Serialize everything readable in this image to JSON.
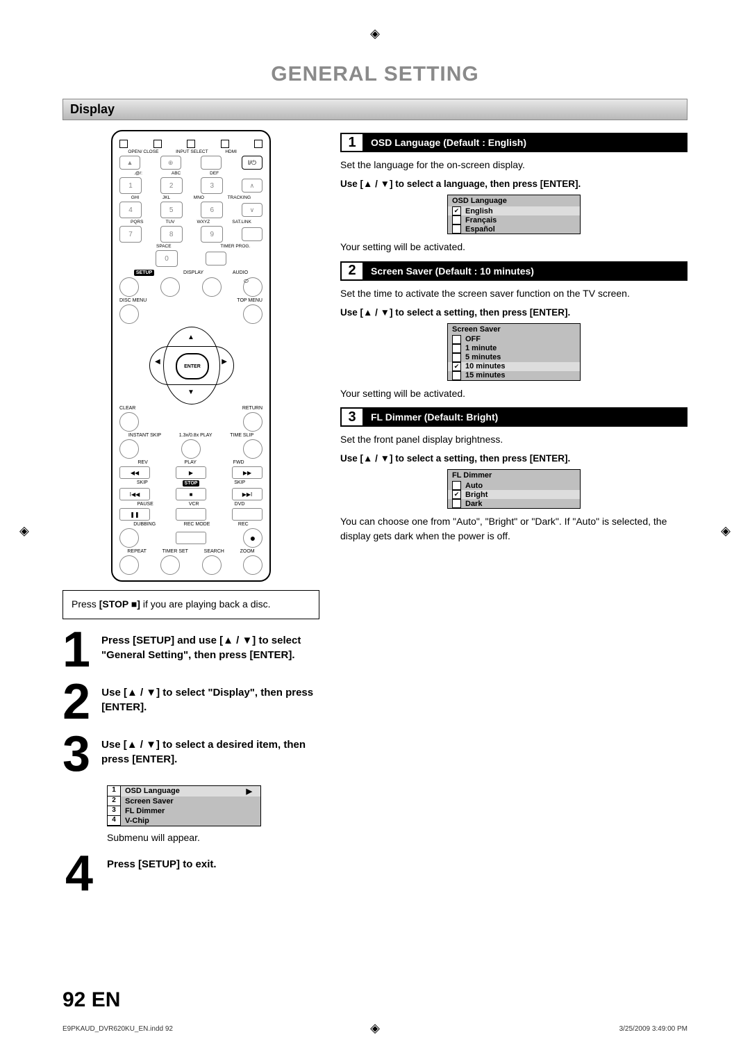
{
  "title": "GENERAL SETTING",
  "section": "Display",
  "caption": {
    "pre": "Press ",
    "bold": "[STOP ■]",
    "post": " if you are playing back a disc."
  },
  "bigsteps": [
    {
      "num": "1",
      "text": "Press [SETUP] and use [▲ / ▼] to select \"General Setting\", then press [ENTER]."
    },
    {
      "num": "2",
      "text": "Use [▲ / ▼] to select \"Display\", then press [ENTER]."
    },
    {
      "num": "3",
      "text": "Use [▲ / ▼] to select a desired item, then press [ENTER]."
    },
    {
      "num": "4",
      "text": "Press [SETUP] to exit."
    }
  ],
  "menu": {
    "rows": [
      {
        "n": "1",
        "label": "OSD Language",
        "selected": true
      },
      {
        "n": "2",
        "label": "Screen Saver"
      },
      {
        "n": "3",
        "label": "FL Dimmer"
      },
      {
        "n": "4",
        "label": "V-Chip"
      }
    ],
    "note": "Submenu will appear."
  },
  "items": [
    {
      "num": "1",
      "title": "OSD Language (Default : English)",
      "body1": "Set the language for the on-screen display.",
      "instr": "Use [▲ / ▼] to select a language, then press [ENTER].",
      "box_title": "OSD Language",
      "options": [
        {
          "label": "English",
          "checked": true,
          "selected": true
        },
        {
          "label": "Français"
        },
        {
          "label": "Español"
        }
      ],
      "body2": "Your setting will be activated."
    },
    {
      "num": "2",
      "title": "Screen Saver (Default : 10 minutes)",
      "body1": "Set the time to activate the screen saver function on the TV screen.",
      "instr": "Use [▲ / ▼] to select a setting, then press [ENTER].",
      "box_title": "Screen Saver",
      "options": [
        {
          "label": "OFF"
        },
        {
          "label": "1 minute"
        },
        {
          "label": "5 minutes"
        },
        {
          "label": "10 minutes",
          "checked": true,
          "selected": true
        },
        {
          "label": "15 minutes"
        }
      ],
      "body2": "Your setting will be activated."
    },
    {
      "num": "3",
      "title": "FL Dimmer (Default: Bright)",
      "body1": "Set the front panel display brightness.",
      "instr": "Use [▲ / ▼] to select a setting, then press [ENTER].",
      "box_title": "FL Dimmer",
      "options": [
        {
          "label": "Auto"
        },
        {
          "label": "Bright",
          "checked": true,
          "selected": true
        },
        {
          "label": "Dark"
        }
      ],
      "body2": "You can choose one from \"Auto\", \"Bright\" or \"Dark\". If \"Auto\" is selected, the display gets dark when the power is off."
    }
  ],
  "footer": {
    "pagenum": "92  EN",
    "left": "E9PKAUD_DVR620KU_EN.indd   92",
    "right": "3/25/2009   3:49:00 PM"
  },
  "remote": {
    "row1": [
      "OPEN/\nCLOSE",
      "INPUT\nSELECT",
      "HDMI",
      ""
    ],
    "numlabels1": [
      ".@/:",
      "ABC",
      "DEF",
      ""
    ],
    "nums1": [
      "1",
      "2",
      "3"
    ],
    "numlabels2": [
      "GHI",
      "JKL",
      "MNO",
      "TRACKING"
    ],
    "nums2": [
      "4",
      "5",
      "6"
    ],
    "numlabels3": [
      "PQRS",
      "TUV",
      "WXYZ",
      "SAT.LINK"
    ],
    "nums3": [
      "7",
      "8",
      "9"
    ],
    "numlabels4": [
      "",
      "SPACE",
      "",
      "TIMER\nPROG."
    ],
    "nums4": [
      "0"
    ],
    "mid": [
      "SETUP",
      "DISPLAY",
      "AUDIO"
    ],
    "menu": [
      "DISC MENU",
      "TOP MENU"
    ],
    "enter": "ENTER",
    "clr": [
      "CLEAR",
      "RETURN"
    ],
    "tiny": [
      "INSTANT\nSKIP",
      "1.3x/0.8x\nPLAY",
      "TIME SLIP"
    ],
    "trans1": [
      "REV",
      "PLAY",
      "FWD"
    ],
    "trans2": [
      "SKIP",
      "STOP",
      "SKIP"
    ],
    "trans3": [
      "PAUSE",
      "VCR",
      "DVD"
    ],
    "trans4": [
      "DUBBING",
      "REC MODE",
      "REC"
    ],
    "bottomrow": [
      "REPEAT",
      "TIMER SET",
      "SEARCH",
      "ZOOM"
    ]
  }
}
